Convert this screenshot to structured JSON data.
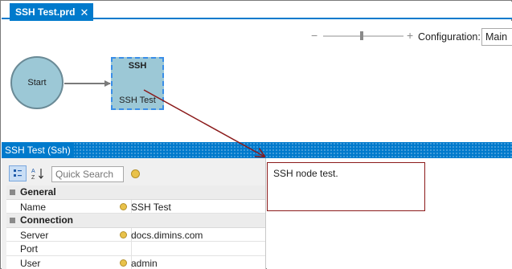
{
  "document_tab": {
    "label": "SSH Test.prd",
    "close_glyph": "✕"
  },
  "designer": {
    "zoom_minus": "−",
    "zoom_plus": "+",
    "zoom_level": 0.48,
    "configuration_label": "Configuration:",
    "configuration_value": "Main",
    "nodes": {
      "start": {
        "label": "Start"
      },
      "ssh": {
        "title": "SSH",
        "subtitle": "SSH Test"
      }
    }
  },
  "panel": {
    "title": "SSH Test (Ssh)"
  },
  "property_grid": {
    "quick_search_placeholder": "Quick Search",
    "categories": [
      {
        "label": "General",
        "properties": [
          {
            "name": "Name",
            "value": "SSH Test"
          }
        ]
      },
      {
        "label": "Connection",
        "properties": [
          {
            "name": "Server",
            "value": "docs.dimins.com"
          },
          {
            "name": "Port",
            "value": ""
          },
          {
            "name": "User",
            "value": "admin"
          }
        ]
      }
    ]
  },
  "description": {
    "text": "SSH node test."
  },
  "colors": {
    "accent": "#007acc",
    "node_fill": "#9cc8d6",
    "annotation": "#8b1a1a"
  },
  "icons": [
    "close-icon",
    "categorized-icon",
    "alphabetical-sort-icon",
    "property-pages-icon"
  ]
}
